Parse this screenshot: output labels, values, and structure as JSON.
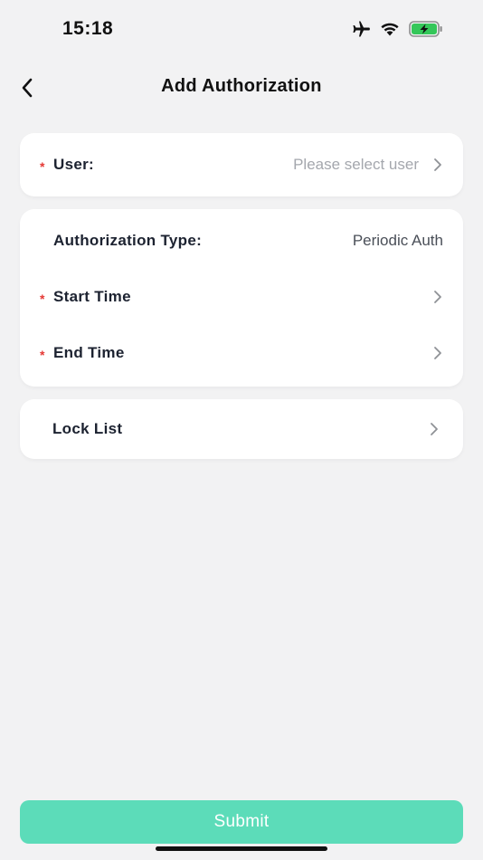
{
  "status_bar": {
    "time": "15:18",
    "icons": [
      "airplane-icon",
      "wifi-icon",
      "battery-charging-icon"
    ],
    "battery_color": "#34c759"
  },
  "nav": {
    "title": "Add Authorization",
    "back_icon": "chevron-left-icon"
  },
  "user_card": {
    "label": "User:",
    "placeholder": "Please select user",
    "required_mark": "*"
  },
  "auth_card": {
    "type_label": "Authorization Type:",
    "type_value": "Periodic Auth",
    "start_label": "Start Time",
    "end_label": "End Time",
    "required_mark": "*"
  },
  "lock_card": {
    "label": "Lock List"
  },
  "submit": {
    "label": "Submit",
    "color": "#5cdcb9"
  }
}
